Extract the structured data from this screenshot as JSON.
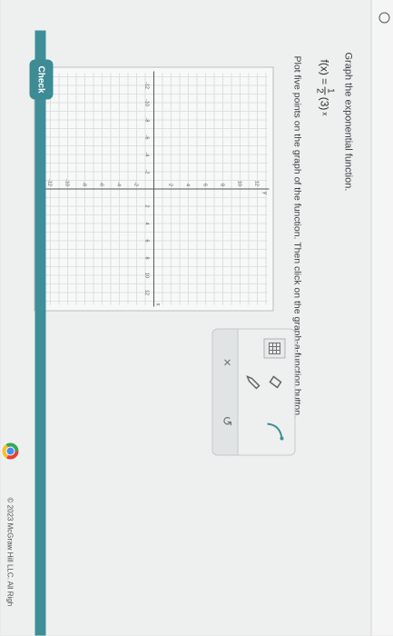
{
  "question": {
    "prompt": "Graph the exponential function.",
    "function_lhs": "f(x) =",
    "coef_num": "1",
    "coef_den": "2",
    "base": "(3)",
    "exponent": "x",
    "instructions": "Plot five points on the graph of the function. Then click on the graph-a-function button."
  },
  "graph": {
    "x_ticks": [
      "-12",
      "-10",
      "-8",
      "-6",
      "-4",
      "-2",
      "2",
      "4",
      "6",
      "8",
      "10",
      "12"
    ],
    "y_ticks": [
      "12",
      "10",
      "8",
      "6",
      "4",
      "2",
      "-2",
      "-4",
      "-6",
      "-8",
      "-10",
      "-12"
    ],
    "x_axis_label": "x",
    "y_axis_label": "y"
  },
  "toolbox": {
    "tools": [
      "grid-tool",
      "eraser-tool",
      "pencil-tool",
      "curve-tool"
    ],
    "clear_label": "×",
    "undo_label": "↺"
  },
  "footer": {
    "check_label": "Check",
    "copyright": "© 2023 McGraw Hill LLC. All Righ"
  }
}
